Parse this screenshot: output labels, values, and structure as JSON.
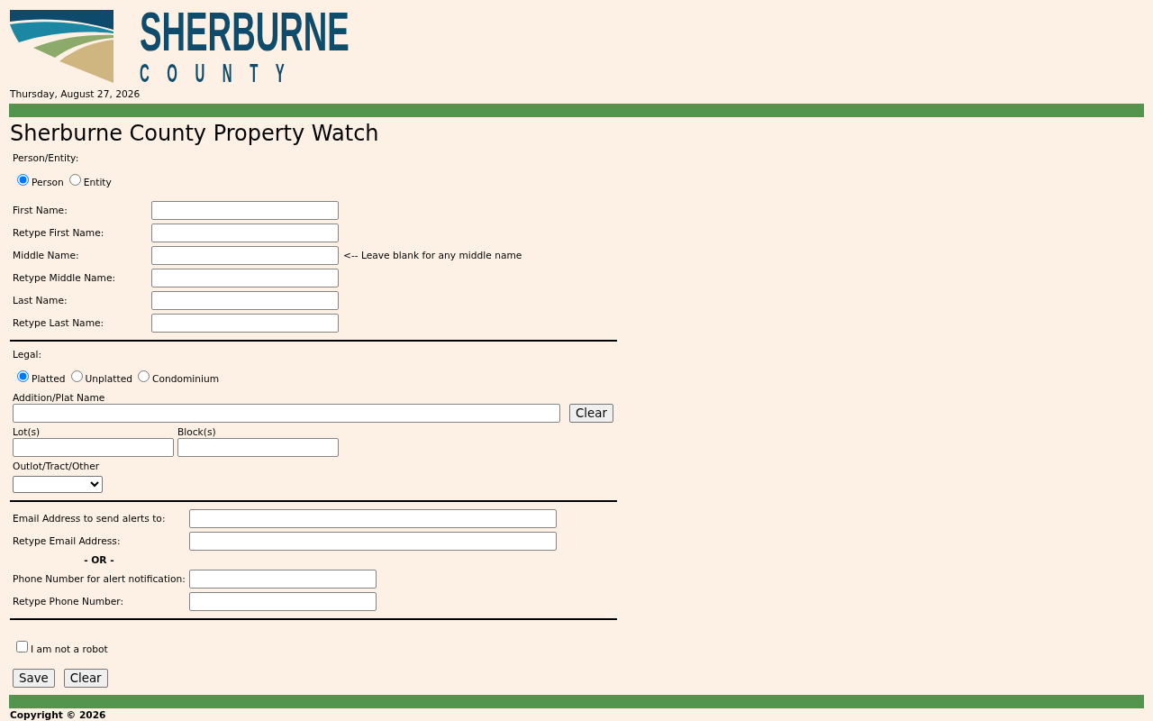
{
  "header": {
    "logo": {
      "title": "SHERBURNE",
      "subtitle": "COUNTY"
    },
    "date": "Thursday, August 27, 2026"
  },
  "page_title": "Sherburne County Property Watch",
  "person_entity": {
    "label": "Person/Entity:",
    "options": [
      {
        "label": "Person",
        "selected": true
      },
      {
        "label": "Entity",
        "selected": false
      }
    ],
    "fields": [
      {
        "label": "First Name:"
      },
      {
        "label": "Retype First Name:"
      },
      {
        "label": "Middle Name:",
        "note": "<-- Leave blank for any middle name"
      },
      {
        "label": "Retype Middle Name:"
      },
      {
        "label": "Last Name:"
      },
      {
        "label": "Retype Last Name:"
      }
    ]
  },
  "legal": {
    "label": "Legal:",
    "options": [
      {
        "label": "Platted",
        "selected": true
      },
      {
        "label": "Unplatted",
        "selected": false
      },
      {
        "label": "Condominium",
        "selected": false
      }
    ],
    "addition_label": "Addition/Plat Name",
    "clear_button": "Clear",
    "lot_label": "Lot(s)",
    "block_label": "Block(s)",
    "outlot_label": "Outlot/Tract/Other"
  },
  "contact": {
    "email_fields": [
      {
        "label": "Email Address to send alerts to:"
      },
      {
        "label": "Retype Email Address:"
      }
    ],
    "or_text": "- OR -",
    "phone_fields": [
      {
        "label": "Phone Number for alert notification:"
      },
      {
        "label": "Retype Phone Number:"
      }
    ]
  },
  "robot_check": {
    "label": "I am not a robot",
    "checked": false
  },
  "buttons": [
    "Save",
    "Clear"
  ],
  "footer": {
    "copyright": "Copyright © 2026"
  }
}
